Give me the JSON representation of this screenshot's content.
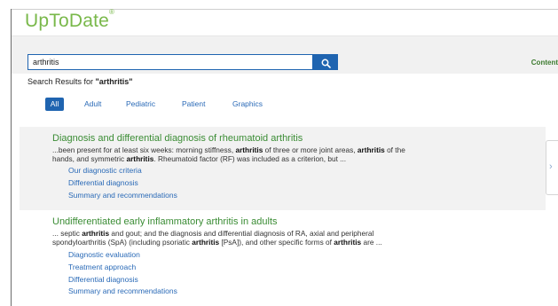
{
  "app": {
    "logo_text": "UpToDate",
    "logo_mark": "®"
  },
  "search": {
    "value": "arthritis",
    "placeholder": ""
  },
  "header": {
    "contents_link": "Content"
  },
  "results": {
    "prefix": "Search Results for ",
    "query_quoted": "\"arthritis\""
  },
  "tabs": [
    {
      "label": "All",
      "active": true
    },
    {
      "label": "Adult",
      "active": false
    },
    {
      "label": "Pediatric",
      "active": false
    },
    {
      "label": "Patient",
      "active": false
    },
    {
      "label": "Graphics",
      "active": false
    }
  ],
  "result_items": [
    {
      "title": "Diagnosis and differential diagnosis of rheumatoid arthritis",
      "snippet_lines": [
        [
          {
            "t": "...been present for at least six weeks: morning stiffness, ",
            "b": false
          },
          {
            "t": "arthritis",
            "b": true
          },
          {
            "t": " of three or more joint areas, ",
            "b": false
          },
          {
            "t": "arthritis",
            "b": true
          },
          {
            "t": " of the",
            "b": false
          }
        ],
        [
          {
            "t": "hands, and symmetric ",
            "b": false
          },
          {
            "t": "arthritis",
            "b": true
          },
          {
            "t": ". Rheumatoid factor (RF) was included as a criterion, but ...",
            "b": false
          }
        ]
      ],
      "links": [
        "Our diagnostic criteria",
        "Differential diagnosis",
        "Summary and recommendations"
      ]
    },
    {
      "title": "Undifferentiated early inflammatory arthritis in adults",
      "snippet_lines": [
        [
          {
            "t": "... septic ",
            "b": false
          },
          {
            "t": "arthritis",
            "b": true
          },
          {
            "t": " and gout; and the diagnosis and differential diagnosis of RA, axial and peripheral",
            "b": false
          }
        ],
        [
          {
            "t": "spondyloarthritis (SpA) (including psoriatic ",
            "b": false
          },
          {
            "t": "arthritis",
            "b": true
          },
          {
            "t": " [PsA]), and other specific forms of ",
            "b": false
          },
          {
            "t": "arthritis",
            "b": true
          },
          {
            "t": " are ...",
            "b": false
          }
        ]
      ],
      "links": [
        "Diagnostic evaluation",
        "Treatment approach",
        "Differential diagnosis",
        "Summary and recommendations"
      ]
    }
  ],
  "side_panel": {
    "arrow": "›"
  },
  "colors": {
    "brand_green": "#79b84a",
    "link_blue": "#2a6ab7",
    "title_green": "#3a8c34",
    "primary_blue": "#1f64b0"
  }
}
